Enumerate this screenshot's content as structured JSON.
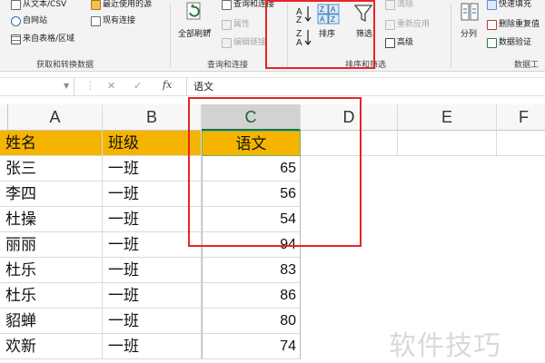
{
  "ribbon": {
    "get_transform": {
      "items": [
        "从文本/CSV",
        "自网站",
        "来自表格/区域",
        "最近使用的源",
        "现有连接"
      ],
      "caption": "获取和转换数据"
    },
    "queries": {
      "refresh_all": "全部刷新",
      "items": [
        "查询和连接",
        "属性",
        "编辑链接"
      ],
      "caption": "查询和连接"
    },
    "sort_filter": {
      "sort": "排序",
      "filter": "筛选",
      "clear": "清除",
      "reapply": "重新应用",
      "advanced": "高级",
      "caption": "排序和筛选"
    },
    "data_tools": {
      "split": "分列",
      "items": [
        "快速填充",
        "删除重复值",
        "数据验证"
      ],
      "caption": "数据工"
    }
  },
  "formula_bar": {
    "fx": "fx",
    "content": "语文"
  },
  "columns": [
    "A",
    "B",
    "C",
    "D",
    "E",
    "F"
  ],
  "table": {
    "headers": [
      "姓名",
      "班级",
      "语文"
    ],
    "rows": [
      [
        "张三",
        "一班",
        "65"
      ],
      [
        "李四",
        "一班",
        "56"
      ],
      [
        "杜操",
        "一班",
        "54"
      ],
      [
        "丽丽",
        "一班",
        "94"
      ],
      [
        "杜乐",
        "一班",
        "83"
      ],
      [
        "杜乐",
        "一班",
        "86"
      ],
      [
        "貂蝉",
        "一班",
        "80"
      ],
      [
        "欢新",
        "一班",
        "74"
      ]
    ]
  },
  "watermark": "软件技巧",
  "colors": {
    "header_fill": "#f5b400",
    "highlight_box": "#e8232a",
    "selected_column": "#d2d2d2"
  }
}
